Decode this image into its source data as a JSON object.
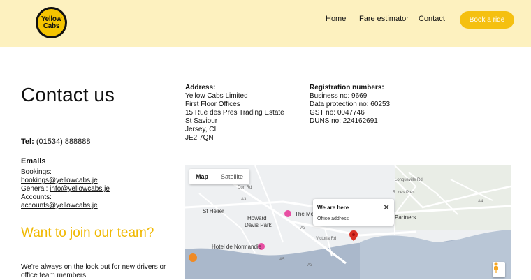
{
  "header": {
    "logo_top": "Yellow",
    "logo_bottom": "Cabs",
    "nav": [
      "Home",
      "Fare estimator",
      "Contact"
    ],
    "book_button": "Book a ride"
  },
  "contact": {
    "title": "Contact us",
    "tel_label": "Tel:",
    "tel_value": "(01534) 888888",
    "emails_heading": "Emails",
    "bookings_label": "Bookings:",
    "bookings_email": "bookings@yellowcabs.je",
    "general_label": "General:",
    "general_email": "info@yellowcabs.je",
    "accounts_label": "Accounts:",
    "accounts_email": "accounts@yellowcabs.je"
  },
  "join": {
    "title": "Want to join our team?",
    "text": "We're always on the look out for new drivers or office team members."
  },
  "address": {
    "heading": "Address:",
    "lines": [
      "Yellow Cabs Limited",
      "First Floor Offices",
      "15 Rue des Pres Trading Estate",
      "St Saviour",
      "Jersey, CI",
      "JE2 7QN"
    ]
  },
  "registration": {
    "heading": "Registration numbers:",
    "lines": [
      "Business no: 9669",
      "Data protection no: 60253",
      "GST no: 0047746",
      "DUNS no: 224162691"
    ]
  },
  "map": {
    "tab_map": "Map",
    "tab_satellite": "Satellite",
    "popup_title": "We are here",
    "popup_subtitle": "Office address",
    "labels": {
      "st_helier": "St Helier",
      "howard": "Howard",
      "davis_park": "Davis Park",
      "hotel": "Hotel de Normandie",
      "the_me": "The Me",
      "partners": "Partners",
      "a3_1": "A3",
      "a3_2": "A3",
      "a3_3": "A3",
      "a5": "A5",
      "a4": "A4",
      "longueville": "Longueville Rd",
      "rue_des_pres": "R. des Pres",
      "victoria": "Victoria Rd",
      "don_rd": "Don Rd"
    }
  }
}
